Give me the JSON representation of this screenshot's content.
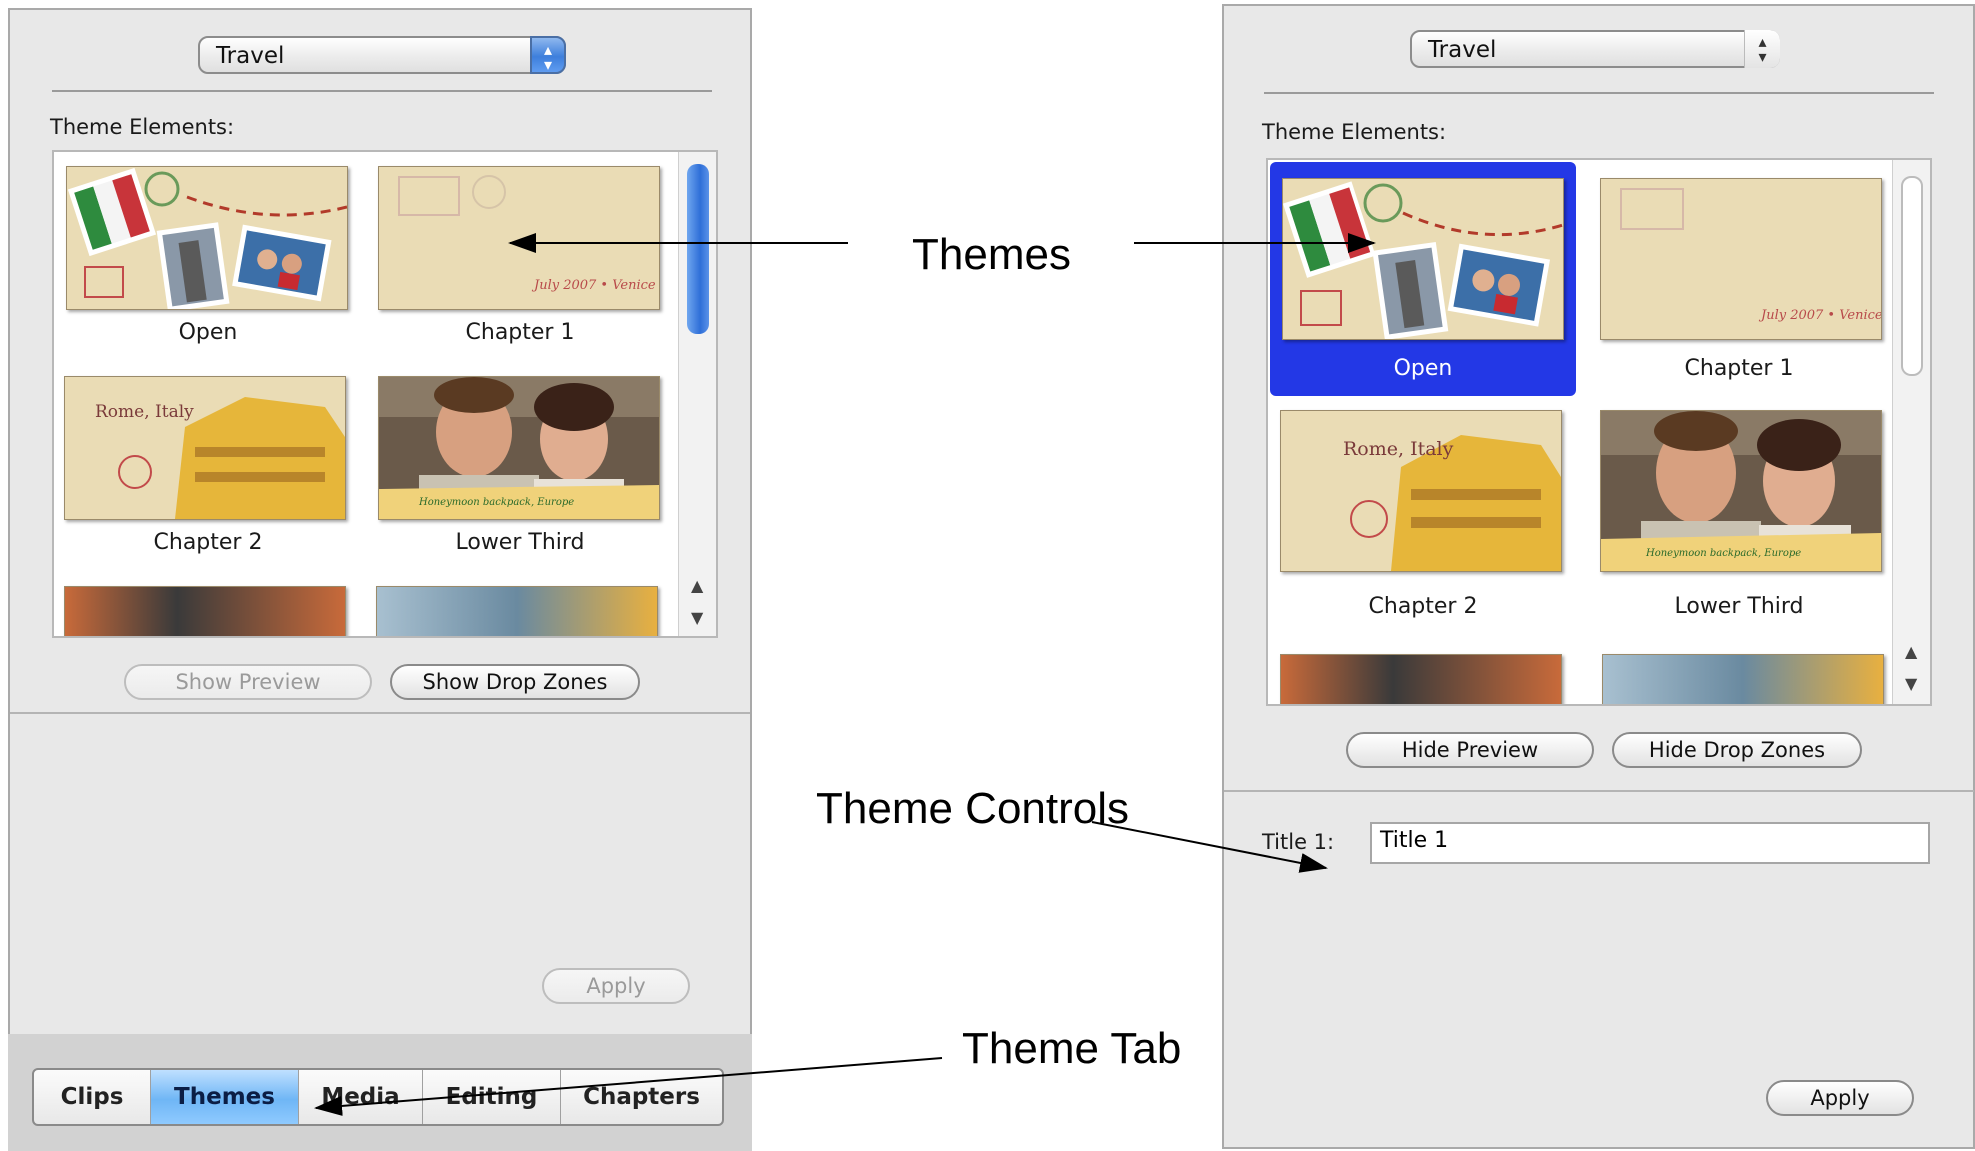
{
  "left_panel": {
    "theme_set": "Travel",
    "section_label": "Theme Elements:",
    "elements": [
      {
        "label": "Open"
      },
      {
        "label": "Chapter 1"
      },
      {
        "label": "Chapter 2"
      },
      {
        "label": "Lower Third"
      }
    ],
    "thumb_text": {
      "chapter1_caption": "July 2007 • Venice",
      "chapter2_caption": "Rome, Italy",
      "lower_third_caption": "Honeymoon backpack, Europe"
    },
    "buttons": {
      "show_preview": "Show Preview",
      "show_drop_zones": "Show Drop Zones",
      "apply": "Apply"
    },
    "tabs": [
      {
        "label": "Clips",
        "active": false
      },
      {
        "label": "Themes",
        "active": true
      },
      {
        "label": "Media",
        "active": false
      },
      {
        "label": "Editing",
        "active": false
      },
      {
        "label": "Chapters",
        "active": false
      }
    ]
  },
  "right_panel": {
    "theme_set": "Travel",
    "section_label": "Theme Elements:",
    "elements": [
      {
        "label": "Open",
        "selected": true
      },
      {
        "label": "Chapter 1"
      },
      {
        "label": "Chapter 2"
      },
      {
        "label": "Lower Third"
      }
    ],
    "buttons": {
      "hide_preview": "Hide Preview",
      "hide_drop_zones": "Hide Drop Zones",
      "apply": "Apply"
    },
    "title_label": "Title 1:",
    "title_value": "Title 1"
  },
  "annotations": {
    "themes": "Themes",
    "theme_controls": "Theme Controls",
    "theme_tab": "Theme Tab"
  },
  "colors": {
    "selection": "#2338e6",
    "panel_bg": "#e8e8e8",
    "active_tab": "#6fb6f5"
  }
}
